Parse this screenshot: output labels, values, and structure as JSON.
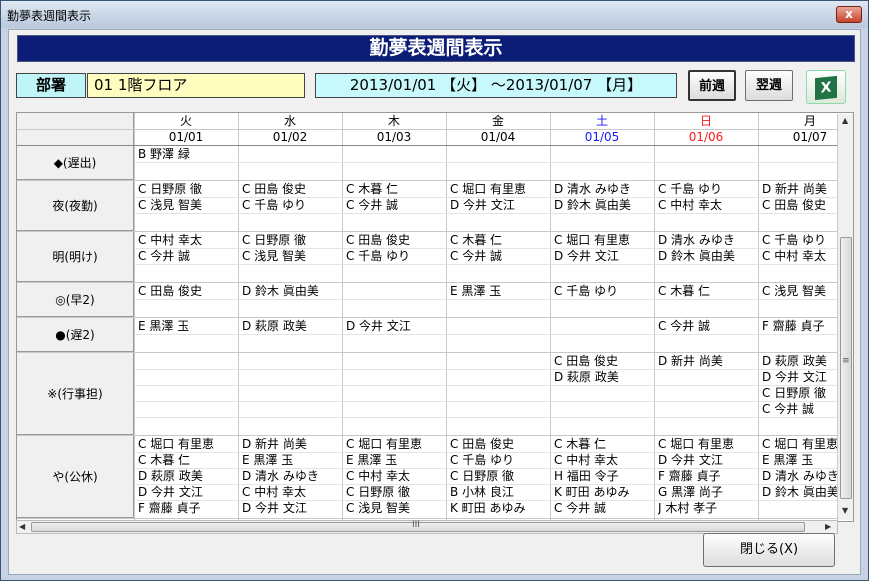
{
  "window": {
    "title": "勤夢表週間表示",
    "close_glyph": "x"
  },
  "header": {
    "title": "勤夢表週間表示"
  },
  "dept": {
    "label": "部署",
    "value": "01 1階フロア"
  },
  "range": {
    "text": "2013/01/01 【火】 ～2013/01/07 【月】"
  },
  "buttons": {
    "prev": "前週",
    "next": "翌週",
    "close": "閉じる(X)",
    "excel_icon": "X"
  },
  "days": [
    {
      "dow": "火",
      "date": "01/01",
      "color": "#000000"
    },
    {
      "dow": "水",
      "date": "01/02",
      "color": "#000000"
    },
    {
      "dow": "木",
      "date": "01/03",
      "color": "#000000"
    },
    {
      "dow": "金",
      "date": "01/04",
      "color": "#000000"
    },
    {
      "dow": "土",
      "date": "01/05",
      "color": "#1a1aff"
    },
    {
      "dow": "日",
      "date": "01/06",
      "color": "#ff1a1a"
    },
    {
      "dow": "月",
      "date": "01/07",
      "color": "#000000"
    }
  ],
  "rows": [
    {
      "label": "◆(遅出)",
      "lines": 2,
      "cells": [
        [
          "B 野澤 緑"
        ],
        [],
        [],
        [],
        [],
        [],
        []
      ]
    },
    {
      "label": "夜(夜勤)",
      "lines": 3,
      "cells": [
        [
          "C 日野原 徹",
          "C 浅見 智美"
        ],
        [
          "C 田島 俊史",
          "C 千島 ゆり"
        ],
        [
          "C 木暮 仁",
          "C 今井 誠"
        ],
        [
          "C 堀口 有里恵",
          "D 今井 文江"
        ],
        [
          "D 清水 みゆき",
          "D 鈴木 眞由美"
        ],
        [
          "C 千島 ゆり",
          "C 中村 幸太"
        ],
        [
          "D 新井 尚美",
          "C 田島 俊史"
        ]
      ]
    },
    {
      "label": "明(明け)",
      "lines": 3,
      "cells": [
        [
          "C 中村 幸太",
          "C 今井 誠"
        ],
        [
          "C 日野原 徹",
          "C 浅見 智美"
        ],
        [
          "C 田島 俊史",
          "C 千島 ゆり"
        ],
        [
          "C 木暮 仁",
          "C 今井 誠"
        ],
        [
          "C 堀口 有里恵",
          "D 今井 文江"
        ],
        [
          "D 清水 みゆき",
          "D 鈴木 眞由美"
        ],
        [
          "C 千島 ゆり",
          "C 中村 幸太"
        ]
      ]
    },
    {
      "label": "◎(早2)",
      "lines": 2,
      "cells": [
        [
          "C 田島 俊史"
        ],
        [
          "D 鈴木 眞由美"
        ],
        [],
        [
          "E 黒澤 玉"
        ],
        [
          "C 千島 ゆり"
        ],
        [
          "C 木暮 仁"
        ],
        [
          "C 浅見 智美"
        ]
      ]
    },
    {
      "label": "●(遅2)",
      "lines": 2,
      "cells": [
        [
          "E 黒澤 玉"
        ],
        [
          "D 萩原 政美"
        ],
        [
          "D 今井 文江"
        ],
        [],
        [],
        [
          "C 今井 誠"
        ],
        [
          "F 齋藤 貞子"
        ]
      ]
    },
    {
      "label": "※(行事担)",
      "lines": 5,
      "cells": [
        [],
        [],
        [],
        [],
        [
          "C 田島 俊史",
          "D 萩原 政美"
        ],
        [
          "D 新井 尚美"
        ],
        [
          "D 萩原 政美",
          "D 今井 文江",
          "C 日野原 徹",
          "C 今井 誠"
        ]
      ]
    },
    {
      "label": "や(公休)",
      "lines": 5,
      "cells": [
        [
          "C 堀口 有里恵",
          "C 木暮 仁",
          "D 萩原 政美",
          "D 今井 文江",
          "F 齋藤 貞子"
        ],
        [
          "D 新井 尚美",
          "E 黒澤 玉",
          "D 清水 みゆき",
          "C 中村 幸太",
          "D 今井 文江"
        ],
        [
          "C 堀口 有里恵",
          "E 黒澤 玉",
          "C 中村 幸太",
          "C 日野原 徹",
          "C 浅見 智美"
        ],
        [
          "C 田島 俊史",
          "C 千島 ゆり",
          "C 日野原 徹",
          "B 小林 良江",
          "K 町田 あゆみ"
        ],
        [
          "C 木暮 仁",
          "C 中村 幸太",
          "H 福田 令子",
          "K 町田 あゆみ",
          "C 今井 誠"
        ],
        [
          "C 堀口 有里恵",
          "D 今井 文江",
          "F 齋藤 貞子",
          "G 黒澤 尚子",
          "J 木村 孝子"
        ],
        [
          "C 堀口 有里恵",
          "E 黒澤 玉",
          "D 清水 みゆき",
          "D 鈴木 眞由美"
        ]
      ]
    }
  ],
  "scroll": {
    "h_thumb_glyph": "III",
    "v_thumb_glyph": "≡"
  }
}
